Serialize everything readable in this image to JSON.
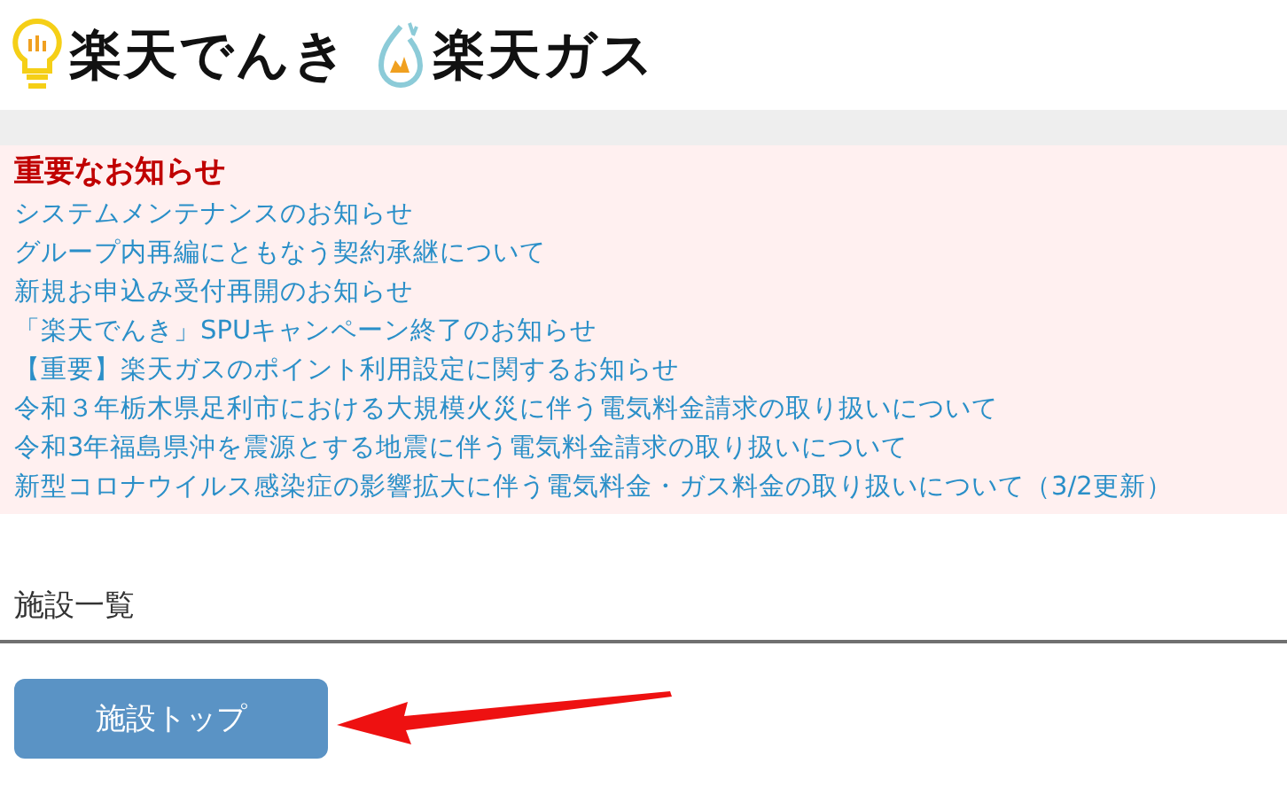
{
  "logos": [
    {
      "kind": "bulb",
      "text": "楽天でんき"
    },
    {
      "kind": "flame",
      "text": "楽天ガス"
    }
  ],
  "notices": {
    "title": "重要なお知らせ",
    "items": [
      "システムメンテナンスのお知らせ",
      "グループ内再編にともなう契約承継について",
      "新規お申込み受付再開のお知らせ",
      "「楽天でんき」SPUキャンペーン終了のお知らせ",
      "【重要】楽天ガスのポイント利用設定に関するお知らせ",
      "令和３年栃木県足利市における大規模火災に伴う電気料金請求の取り扱いについて",
      "令和3年福島県沖を震源とする地震に伴う電気料金請求の取り扱いについて",
      "新型コロナウイルス感染症の影響拡大に伴う電気料金・ガス料金の取り扱いについて（3/2更新）"
    ]
  },
  "section": {
    "heading": "施設一覧"
  },
  "button": {
    "label": "施設トップ"
  }
}
